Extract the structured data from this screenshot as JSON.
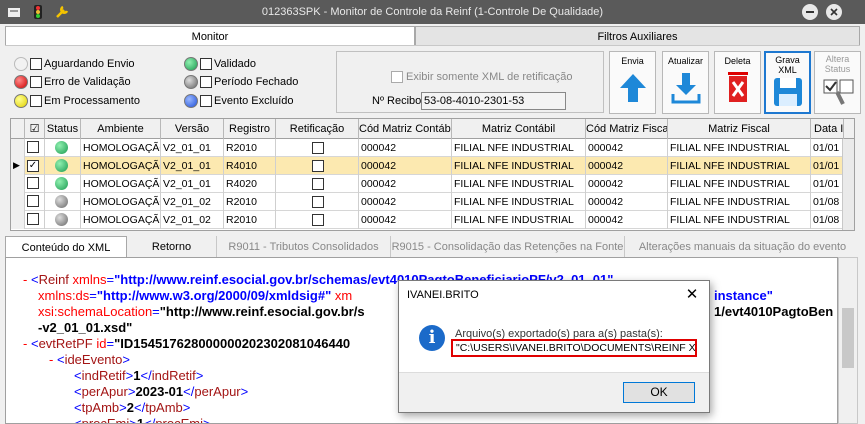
{
  "window": {
    "title": "012363SPK - Monitor de Controle da Reinf (1-Controle De Qualidade)"
  },
  "top_tabs": [
    {
      "label": "Monitor",
      "active": true
    },
    {
      "label": "Filtros Auxiliares",
      "active": false
    }
  ],
  "legend": {
    "aguardando": "Aguardando Envio",
    "erro": "Erro de Validação",
    "processamento": "Em Processamento",
    "validado": "Validado",
    "periodo": "Período Fechado",
    "excluido": "Evento Excluído"
  },
  "filters": {
    "exibir_retificacao": "Exibir somente XML de retificação",
    "recibo_label": "Nº Recibo:",
    "recibo_value": "53-08-4010-2301-53"
  },
  "toolbar": {
    "envia": "Envia",
    "atualizar": "Atualizar",
    "deleta": "Deleta",
    "grava_xml": "Grava XML",
    "altera_status": "Altera Status"
  },
  "grid": {
    "headers": [
      "☑",
      "Status",
      "Ambiente",
      "Versão",
      "Registro",
      "Retificação",
      "Cód Matriz Contábil",
      "Matriz Contábil",
      "Cód Matriz Fiscal",
      "Matriz Fiscal",
      "Data I"
    ],
    "rows": [
      {
        "ambiente": "HOMOLOGAÇÃO",
        "versao": "V2_01_01",
        "registro": "R2010",
        "cod_contabil": "000042",
        "matriz_contabil": "FILIAL NFE INDUSTRIAL",
        "cod_fiscal": "000042",
        "matriz_fiscal": "FILIAL NFE INDUSTRIAL",
        "data": "01/01"
      },
      {
        "ambiente": "HOMOLOGAÇÃO",
        "versao": "V2_01_01",
        "registro": "R4010",
        "cod_contabil": "000042",
        "matriz_contabil": "FILIAL NFE INDUSTRIAL",
        "cod_fiscal": "000042",
        "matriz_fiscal": "FILIAL NFE INDUSTRIAL",
        "data": "01/01"
      },
      {
        "ambiente": "HOMOLOGAÇÃO",
        "versao": "V2_01_01",
        "registro": "R4020",
        "cod_contabil": "000042",
        "matriz_contabil": "FILIAL NFE INDUSTRIAL",
        "cod_fiscal": "000042",
        "matriz_fiscal": "FILIAL NFE INDUSTRIAL",
        "data": "01/01"
      },
      {
        "ambiente": "HOMOLOGAÇÃO",
        "versao": "V2_01_02",
        "registro": "R2010",
        "cod_contabil": "000042",
        "matriz_contabil": "FILIAL NFE INDUSTRIAL",
        "cod_fiscal": "000042",
        "matriz_fiscal": "FILIAL NFE INDUSTRIAL",
        "data": "01/08"
      },
      {
        "ambiente": "HOMOLOGAÇÃO",
        "versao": "V2_01_02",
        "registro": "R2010",
        "cod_contabil": "000042",
        "matriz_contabil": "FILIAL NFE INDUSTRIAL",
        "cod_fiscal": "000042",
        "matriz_fiscal": "FILIAL NFE INDUSTRIAL",
        "data": "01/08"
      }
    ]
  },
  "bottom_tabs": [
    {
      "label": "Conteúdo do XML",
      "state": "active"
    },
    {
      "label": "Retorno",
      "state": "enabled"
    },
    {
      "label": "R9011 - Tributos Consolidados",
      "state": "disabled"
    },
    {
      "label": "R9015 - Consolidação das Retenções na Fonte",
      "state": "disabled"
    },
    {
      "label": "Alterações manuais da situação do evento",
      "state": "disabled"
    }
  ],
  "xml": {
    "l1_tag": "Reinf",
    "l1_attr": "xmlns",
    "l1_val": "\"http://www.reinf.esocial.gov.br/schemas/evt4010PagtoBeneficiarioPF/v2_01_01\"",
    "l2_attr": "xmlns:ds",
    "l2_val": "\"http://www.w3.org/2000/09/xmldsig#\"",
    "l2_attr2": "xm",
    "l2_tail": "instance\"",
    "l3_attr": "xsi:schemaLocation",
    "l3_val": "\"http://www.reinf.esocial.gov.br/s",
    "l3_tail": "1/evt4010PagtoBen",
    "l4_val": "-v2_01_01.xsd\"",
    "l5_tag": "evtRetPF",
    "l5_attr": "id",
    "l5_val": "\"ID154517628000000202302081046440",
    "l6_tag": "ideEvento",
    "l7_tag": "indRetif",
    "l7_val": "1",
    "l8_tag": "perApur",
    "l8_val": "2023-01",
    "l9_tag": "tpAmb",
    "l9_val": "2",
    "l10_tag": "procEmi",
    "l10_val": "1"
  },
  "dialog": {
    "title": "IVANEI.BRITO",
    "message": "Arquivo(s) exportado(s) para a(s) pasta(s):",
    "path": "\"C:\\USERS\\IVANEI.BRITO\\DOCUMENTS\\REINF XML\\\"",
    "ok": "OK"
  },
  "colors": {
    "titlebar": "#5a5a5a",
    "selected_row": "#fce9b0",
    "highlight_border": "#e00000",
    "info_icon": "#1b6ac9"
  }
}
